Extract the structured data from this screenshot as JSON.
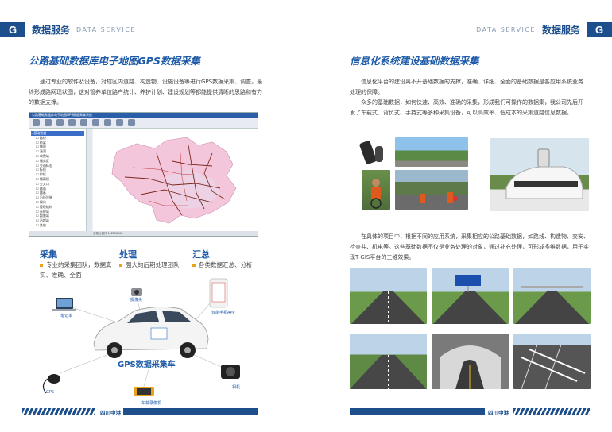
{
  "left_header": {
    "g": "G",
    "cn": "数据服务",
    "en": "DATA SERVICE"
  },
  "right_header": {
    "g": "G",
    "cn": "数据服务",
    "en": "DATA SERVICE"
  },
  "left": {
    "title": "公路基础数据库电子地图GPS数据采集",
    "para": "通过专业的软件及设备，对辖区内道路、构造物、设施设备等进行GPS数据采集、调查。最终形成路网现状图，这对管养单位路产统计、养护计划、建设规划等都能提供清晰的思路和有力的数据支撑。",
    "app_window": {
      "title": "公路基础数据库电子地图GPS数据采集系统",
      "tree_items": [
        "基础数据",
        "路线",
        "桥梁",
        "隧道",
        "涵洞",
        "收费站",
        "服务区",
        "交通标志",
        "标线",
        "护栏",
        "隔离栅",
        "交叉口",
        "路面",
        "路基",
        "沿线设施",
        "绿化",
        "管理机构",
        "养护站",
        "超限站",
        "治超站",
        "其他"
      ],
      "status": "当前比例尺 1:4500000"
    },
    "features": [
      {
        "title": "采集",
        "text": "专业的采集团队，数据真实、准确、全面"
      },
      {
        "title": "处理",
        "text": "强大的后期处理团队"
      },
      {
        "title": "汇总",
        "text": "各类数据汇总、分析"
      }
    ],
    "diagram": {
      "car_label": "GPS数据采集车",
      "laptop": "笔记本",
      "camera_top": "摄像头",
      "phone": "智能手机APP",
      "gps": "GPS",
      "recorder": "车载录像机",
      "camera": "相机"
    },
    "footer": "四川中港"
  },
  "right": {
    "title": "信息化系统建设基础数据采集",
    "para1": "信息化平台的建设离不开基础数据的支撑，准确、详细、全面的基础数据是各应用系统业务处理的保障。",
    "para2": "众多的基础数据，如何快速、高效、准确的采集，形成我们可操作的数据集，我公司先后开发了车载式、背负式、手持式等多种采集设备，可以高效率、低成本的采集道路信息数据。",
    "para3": "在具体的项目中，根据不同的应用系统，采集相应的公路基础数据，如路线、构造物、交安、检查井、机电等。这些基础数据不仅是业务处理的对象，通过补充处理，可形成多维数据，用于实现T-GIS平台的三维效果。",
    "footer": "四川中港"
  }
}
